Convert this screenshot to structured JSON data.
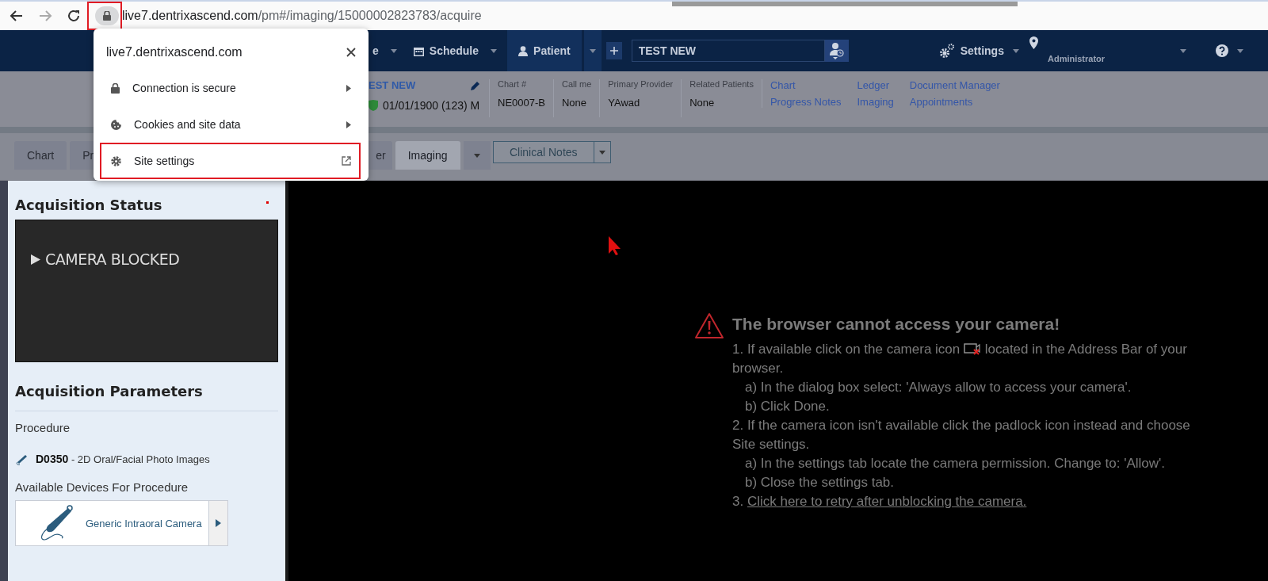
{
  "browser": {
    "url_host": "live7.dentrixascend.com",
    "url_path": "/pm#/imaging/15000002823783/acquire"
  },
  "site_popup": {
    "title": "live7.dentrixascend.com",
    "items": [
      {
        "label": "Connection is secure",
        "kind": "submenu",
        "highlighted": false
      },
      {
        "label": "Cookies and site data",
        "kind": "submenu",
        "highlighted": false
      },
      {
        "label": "Site settings",
        "kind": "external",
        "highlighted": true
      }
    ]
  },
  "nav": {
    "items": [
      {
        "label": "e",
        "kind": "plain",
        "selected": false
      },
      {
        "label": "Schedule",
        "kind": "calendar",
        "selected": false
      },
      {
        "label": "Patient",
        "kind": "person",
        "selected": true
      }
    ],
    "search": {
      "value": "TEST NEW"
    },
    "settings": "Settings",
    "location": "Administrator"
  },
  "patient": {
    "name": "EST NEW",
    "dob": "01/01/1900 (123) M",
    "fields": [
      {
        "label": "Chart #",
        "value": "NE0007-B"
      },
      {
        "label": "Call me",
        "value": "None"
      },
      {
        "label": "Primary Provider",
        "value": "YAwad"
      },
      {
        "label": "Related Patients",
        "value": "None"
      }
    ],
    "link_columns": [
      {
        "links": [
          "Chart",
          "Progress Notes"
        ]
      },
      {
        "links": [
          "Ledger",
          "Imaging"
        ]
      },
      {
        "links": [
          "Document Manager",
          "Appointments"
        ]
      }
    ]
  },
  "tabs": [
    {
      "label": "Chart",
      "selected": false
    },
    {
      "label": "Pr",
      "selected": false
    },
    {
      "label": "er",
      "selected": false
    },
    {
      "label": "Imaging",
      "selected": true
    }
  ],
  "clinical_notes": "Clinical Notes",
  "acquisition": {
    "status_title": "Acquisition Status",
    "status": "CAMERA BLOCKED",
    "params_title": "Acquisition Parameters",
    "procedure_label": "Procedure",
    "procedure_code": "D0350",
    "procedure_desc": "- 2D Oral/Facial Photo Images",
    "devices_label": "Available Devices For Procedure",
    "devices": [
      {
        "name": "Generic Intraoral Camera"
      }
    ]
  },
  "message": {
    "title": "The browser cannot access your camera!",
    "steps": [
      {
        "kind": "icon_step",
        "before": "1. If available click on the camera icon",
        "after": "located in the Address Bar of your browser."
      },
      {
        "kind": "sub",
        "text": "a) In the dialog box select: 'Always allow to access your camera'."
      },
      {
        "kind": "sub",
        "text": "b) Click Done."
      },
      {
        "kind": "step",
        "text": "2. If the camera icon isn't available click the padlock icon instead and choose Site settings."
      },
      {
        "kind": "sub",
        "text": "a) In the settings tab locate the camera permission. Change to: 'Allow'."
      },
      {
        "kind": "sub",
        "text": "b) Close the settings tab."
      },
      {
        "kind": "link_step",
        "prefix": "3.",
        "link": "Click here to retry after unblocking the camera."
      }
    ]
  }
}
